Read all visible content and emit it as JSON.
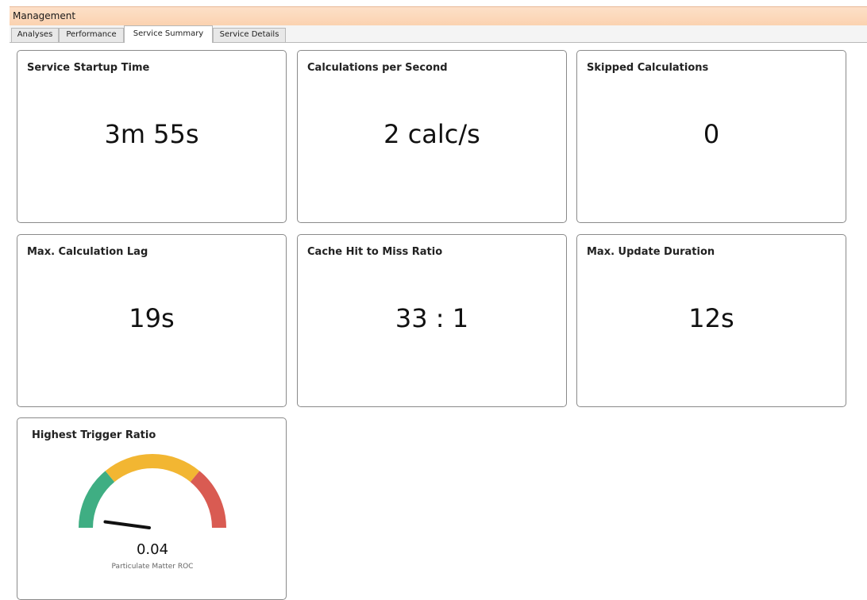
{
  "window": {
    "title": "Management"
  },
  "tabs": [
    {
      "label": "Analyses",
      "active": false
    },
    {
      "label": "Performance",
      "active": false
    },
    {
      "label": "Service Summary",
      "active": true
    },
    {
      "label": "Service Details",
      "active": false
    }
  ],
  "cards": [
    {
      "title": "Service Startup Time",
      "value": "3m 55s"
    },
    {
      "title": "Calculations per Second",
      "value": "2 calc/s"
    },
    {
      "title": "Skipped Calculations",
      "value": "0"
    },
    {
      "title": "Max. Calculation Lag",
      "value": "19s"
    },
    {
      "title": "Cache Hit to Miss Ratio",
      "value": "33 : 1"
    },
    {
      "title": "Max. Update Duration",
      "value": "12s"
    }
  ],
  "gauge": {
    "title": "Highest Trigger Ratio",
    "value": "0.04",
    "label": "Particulate Matter ROC",
    "level": 0.04,
    "colors": {
      "low": "#3fae83",
      "mid": "#f2b632",
      "high": "#d95b52",
      "needle": "#111111"
    }
  }
}
